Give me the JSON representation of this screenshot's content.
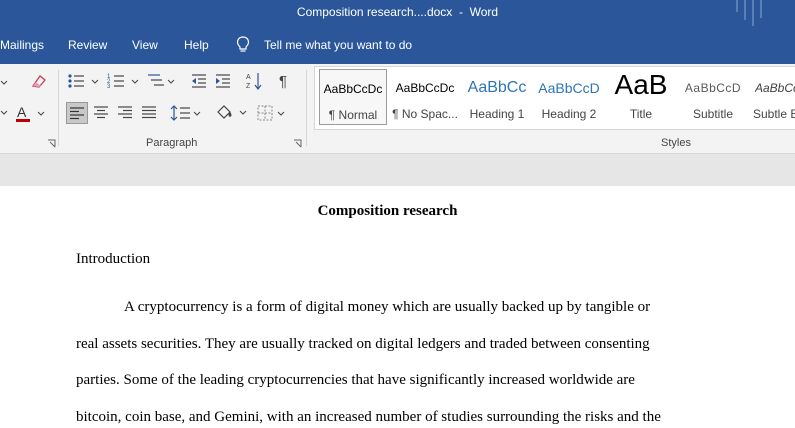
{
  "window": {
    "title": "Composition research....docx  -  Word"
  },
  "menu": {
    "items": [
      "Mailings",
      "Review",
      "View",
      "Help"
    ],
    "tell_me": "Tell me what you want to do"
  },
  "ribbon": {
    "paragraph_label": "Paragraph",
    "styles_label": "Styles",
    "styles": [
      {
        "preview": "AaBbCcDc",
        "name": "¶ Normal"
      },
      {
        "preview": "AaBbCcDc",
        "name": "¶ No Spac..."
      },
      {
        "preview": "AaBbCc",
        "name": "Heading 1"
      },
      {
        "preview": "AaBbCcD",
        "name": "Heading 2"
      },
      {
        "preview": "AaB",
        "name": "Title"
      },
      {
        "preview": "AaBbCcD",
        "name": "Subtitle"
      },
      {
        "preview": "AaBbCcI",
        "name": "Subtle E"
      }
    ],
    "icons": [
      "clear-formatting-icon",
      "bullets-icon",
      "numbering-icon",
      "multilevel-list-icon",
      "decrease-indent-icon",
      "increase-indent-icon",
      "sort-icon",
      "pilcrow-icon",
      "font-color-icon",
      "align-left-icon",
      "center-icon",
      "align-right-icon",
      "justify-icon",
      "line-spacing-icon",
      "shading-icon",
      "borders-icon"
    ],
    "font_color": "#c00000",
    "accent": "#2b579a"
  },
  "document": {
    "title": "Composition research",
    "heading": "Introduction",
    "lines": [
      "A cryptocurrency is a form of digital money which are usually backed up by tangible or",
      "real assets securities. They are usually tracked on digital ledgers and traded between consenting",
      "parties. Some of the leading cryptocurrencies that have significantly increased worldwide are",
      "bitcoin, coin base, and Gemini, with an increased number of studies surrounding the risks and the"
    ]
  }
}
